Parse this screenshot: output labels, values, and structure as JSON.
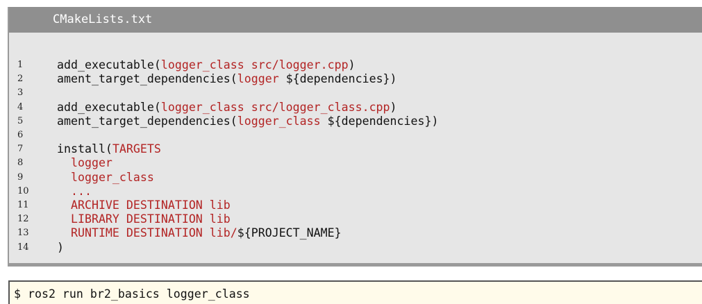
{
  "listing": {
    "filename": "CMakeLists.txt",
    "lines": [
      {
        "number": "1",
        "segments": [
          {
            "text": "add_executable(",
            "color": "black"
          },
          {
            "text": "logger_class src/logger.cpp",
            "color": "red"
          },
          {
            "text": ")",
            "color": "black"
          }
        ]
      },
      {
        "number": "2",
        "segments": [
          {
            "text": "ament_target_dependencies(",
            "color": "black"
          },
          {
            "text": "logger",
            "color": "red"
          },
          {
            "text": " ${dependencies})",
            "color": "black"
          }
        ]
      },
      {
        "number": "3",
        "segments": []
      },
      {
        "number": "4",
        "segments": [
          {
            "text": "add_executable(",
            "color": "black"
          },
          {
            "text": "logger_class src/logger_class.cpp",
            "color": "red"
          },
          {
            "text": ")",
            "color": "black"
          }
        ]
      },
      {
        "number": "5",
        "segments": [
          {
            "text": "ament_target_dependencies(",
            "color": "black"
          },
          {
            "text": "logger_class",
            "color": "red"
          },
          {
            "text": " ${dependencies})",
            "color": "black"
          }
        ]
      },
      {
        "number": "6",
        "segments": []
      },
      {
        "number": "7",
        "segments": [
          {
            "text": "install(",
            "color": "black"
          },
          {
            "text": "TARGETS",
            "color": "red"
          }
        ]
      },
      {
        "number": "8",
        "segments": [
          {
            "text": "  logger",
            "color": "red"
          }
        ]
      },
      {
        "number": "9",
        "segments": [
          {
            "text": "  logger_class",
            "color": "red"
          }
        ]
      },
      {
        "number": "10",
        "segments": [
          {
            "text": "  ...",
            "color": "red"
          }
        ]
      },
      {
        "number": "11",
        "segments": [
          {
            "text": "  ARCHIVE DESTINATION lib",
            "color": "red"
          }
        ]
      },
      {
        "number": "12",
        "segments": [
          {
            "text": "  LIBRARY DESTINATION lib",
            "color": "red"
          }
        ]
      },
      {
        "number": "13",
        "segments": [
          {
            "text": "  RUNTIME DESTINATION lib/",
            "color": "red"
          },
          {
            "text": "${PROJECT_NAME}",
            "color": "black"
          }
        ]
      },
      {
        "number": "14",
        "segments": [
          {
            "text": ")",
            "color": "black"
          }
        ]
      }
    ]
  },
  "terminal": {
    "command": "$ ros2 run br2_basics logger_class"
  },
  "colors": {
    "keyword_red": "#b32424",
    "header_gray": "#8f8f8f",
    "listing_bg": "#e6e6e6",
    "terminal_bg": "#fffbea"
  }
}
